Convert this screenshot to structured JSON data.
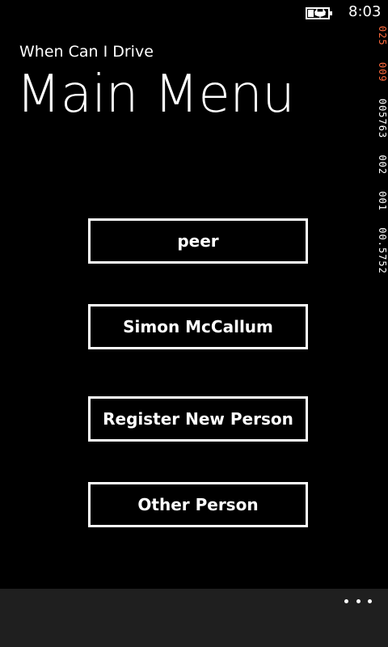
{
  "status_bar": {
    "time": "8:03",
    "battery_icon": "battery-charging-icon"
  },
  "debug_counters": {
    "segments": [
      {
        "text": "025",
        "color": "#ff6a3d"
      },
      {
        "text": "009",
        "color": "#ff6a3d"
      },
      {
        "text": "005763",
        "color": "#ffffff"
      },
      {
        "text": "002",
        "color": "#ffffff"
      },
      {
        "text": "001",
        "color": "#ffffff"
      },
      {
        "text": "00.5752",
        "color": "#ffffff"
      }
    ]
  },
  "header": {
    "app_title": "When Can I Drive",
    "page_title": "Main Menu"
  },
  "menu": {
    "buttons": [
      {
        "label": "peer"
      },
      {
        "label": "Simon McCallum"
      },
      {
        "label": "Register New Person"
      },
      {
        "label": "Other Person"
      }
    ]
  },
  "app_bar": {
    "more_icon": "ellipsis-icon",
    "background": "#1f1f1f"
  }
}
